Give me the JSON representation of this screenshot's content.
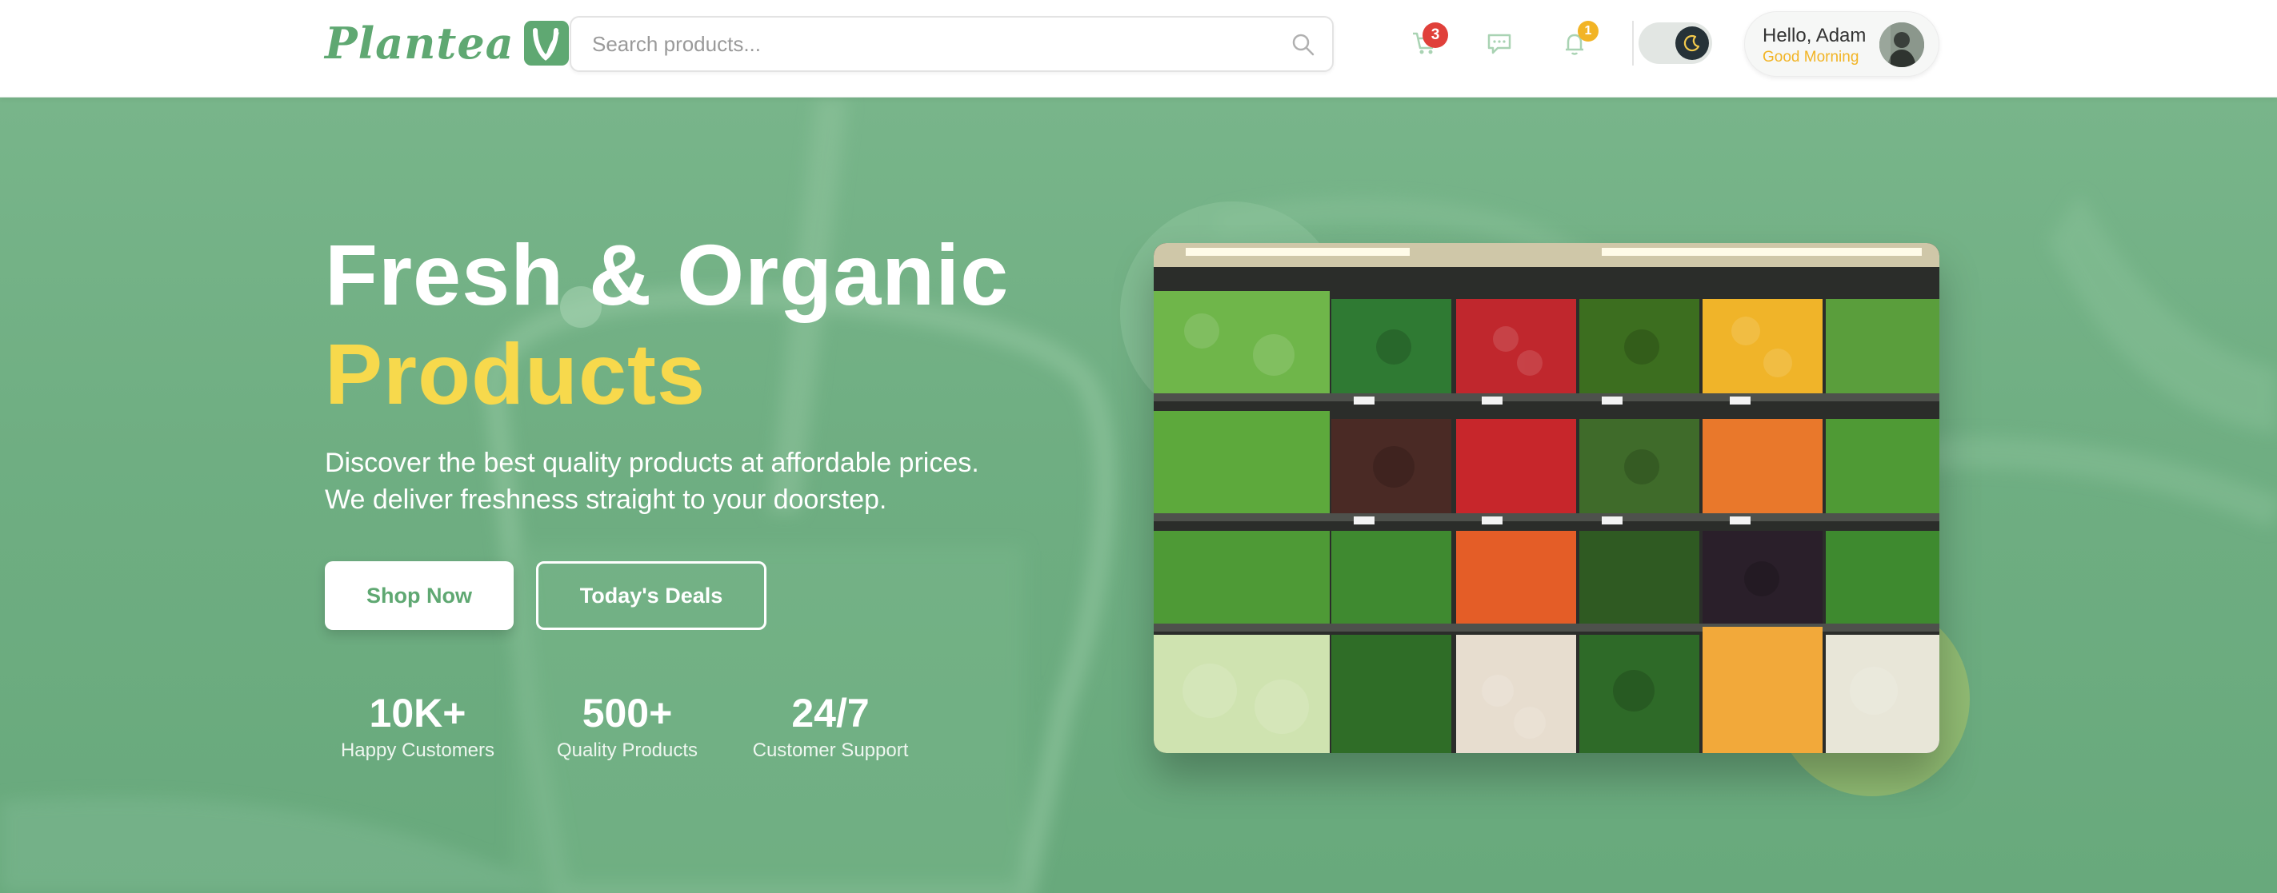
{
  "header": {
    "logo_text": "Plantea",
    "search": {
      "placeholder": "Search products..."
    },
    "cart": {
      "count": "3"
    },
    "notifications": {
      "count": "1"
    },
    "theme": "dark",
    "user": {
      "greeting": "Hello, Adam",
      "subtitle": "Good Morning"
    }
  },
  "hero": {
    "title_line1": "Fresh & Organic",
    "title_line2": "Products",
    "description_line1": "Discover the best quality products at affordable prices.",
    "description_line2": "We deliver freshness straight to your doorstep.",
    "primary_button": "Shop Now",
    "secondary_button": "Today's Deals",
    "stats": [
      {
        "value": "10K+",
        "label": "Happy Customers"
      },
      {
        "value": "500+",
        "label": "Quality Products"
      },
      {
        "value": "24/7",
        "label": "Customer Support"
      }
    ]
  },
  "colors": {
    "brand_green": "#5fa872",
    "hero_bg": "#72b185",
    "accent_yellow": "#f7d94c",
    "badge_red": "#e0403a",
    "badge_yellow": "#f2b425"
  }
}
